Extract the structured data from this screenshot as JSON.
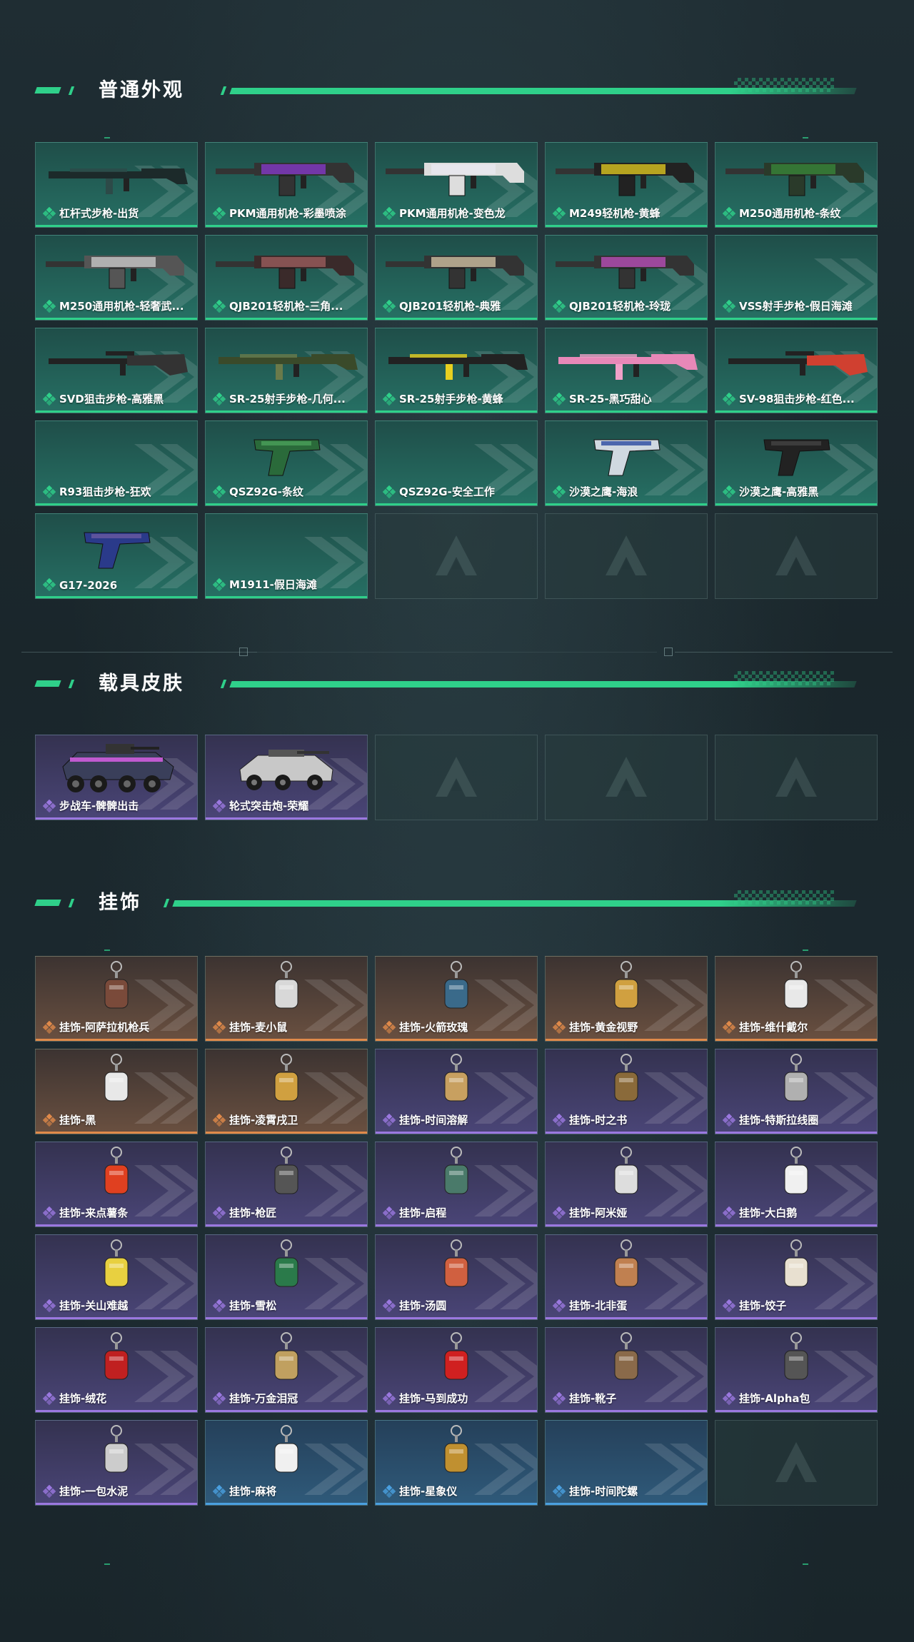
{
  "sections": {
    "weapons": {
      "title": "普通外观",
      "items": [
        {
          "label": "杠杆式步枪-出货",
          "rarity": "green",
          "art": "rifle-dark"
        },
        {
          "label": "PKM通用机枪-彩墨喷涂",
          "rarity": "green",
          "art": "mg-purple"
        },
        {
          "label": "PKM通用机枪-变色龙",
          "rarity": "green",
          "art": "mg-white"
        },
        {
          "label": "M249轻机枪-黄蜂",
          "rarity": "green",
          "art": "mg-yellow"
        },
        {
          "label": "M250通用机枪-条纹",
          "rarity": "green",
          "art": "mg-green"
        },
        {
          "label": "M250通用机枪-轻奢武...",
          "rarity": "green",
          "art": "mg-grey"
        },
        {
          "label": "QJB201轻机枪-三角...",
          "rarity": "green",
          "art": "mg-red"
        },
        {
          "label": "QJB201轻机枪-典雅",
          "rarity": "green",
          "art": "mg-tan"
        },
        {
          "label": "QJB201轻机枪-玲珑",
          "rarity": "green",
          "art": "mg-colorful"
        },
        {
          "label": "VSS射手步枪-假日海滩",
          "rarity": "green",
          "art": "none"
        },
        {
          "label": "SVD狙击步枪-高雅黑",
          "rarity": "green",
          "art": "sniper-black"
        },
        {
          "label": "SR-25射手步枪-几何...",
          "rarity": "green",
          "art": "rifle-camo"
        },
        {
          "label": "SR-25射手步枪-黄蜂",
          "rarity": "green",
          "art": "rifle-yellow"
        },
        {
          "label": "SR-25-黑巧甜心",
          "rarity": "green",
          "art": "rifle-pink"
        },
        {
          "label": "SV-98狙击步枪-红色...",
          "rarity": "green",
          "art": "sniper-red"
        },
        {
          "label": "R93狙击步枪-狂欢",
          "rarity": "green",
          "art": "none"
        },
        {
          "label": "QSZ92G-条纹",
          "rarity": "green",
          "art": "pistol-green"
        },
        {
          "label": "QSZ92G-安全工作",
          "rarity": "green",
          "art": "none"
        },
        {
          "label": "沙漠之鹰-海浪",
          "rarity": "green",
          "art": "pistol-blue"
        },
        {
          "label": "沙漠之鹰-高雅黑",
          "rarity": "green",
          "art": "pistol-black"
        },
        {
          "label": "G17-2026",
          "rarity": "green",
          "art": "pistol-navy"
        },
        {
          "label": "M1911-假日海滩",
          "rarity": "green",
          "art": "none"
        },
        {
          "label": "",
          "rarity": "empty",
          "art": "none"
        },
        {
          "label": "",
          "rarity": "empty",
          "art": "none"
        },
        {
          "label": "",
          "rarity": "empty",
          "art": "none"
        }
      ]
    },
    "vehicles": {
      "title": "载具皮肤",
      "items": [
        {
          "label": "步战车-髀髀出击",
          "rarity": "purple",
          "art": "vehicle-apc"
        },
        {
          "label": "轮式突击炮-荣耀",
          "rarity": "purple",
          "art": "vehicle-car"
        },
        {
          "label": "",
          "rarity": "empty",
          "art": "none"
        },
        {
          "label": "",
          "rarity": "empty",
          "art": "none"
        },
        {
          "label": "",
          "rarity": "empty",
          "art": "none"
        }
      ]
    },
    "charms": {
      "title": "挂饰",
      "items": [
        {
          "label": "挂饰-阿萨拉机枪兵",
          "rarity": "orange",
          "art": "charm-soldier"
        },
        {
          "label": "挂饰-麦小鼠",
          "rarity": "orange",
          "art": "charm-mouse"
        },
        {
          "label": "挂饰-火箭玫瑰",
          "rarity": "orange",
          "art": "charm-rocket"
        },
        {
          "label": "挂饰-黄金视野",
          "rarity": "orange",
          "art": "charm-figure"
        },
        {
          "label": "挂饰-维什戴尔",
          "rarity": "orange",
          "art": "charm-tag"
        },
        {
          "label": "挂饰-黑",
          "rarity": "orange",
          "art": "charm-tag"
        },
        {
          "label": "挂饰-凌霄戌卫",
          "rarity": "orange",
          "art": "charm-figure"
        },
        {
          "label": "挂饰-时间溶解",
          "rarity": "purple",
          "art": "charm-clock"
        },
        {
          "label": "挂饰-时之书",
          "rarity": "purple",
          "art": "charm-book"
        },
        {
          "label": "挂饰-特斯拉线圈",
          "rarity": "purple",
          "art": "charm-coil"
        },
        {
          "label": "挂饰-来点薯条",
          "rarity": "purple",
          "art": "charm-fries"
        },
        {
          "label": "挂饰-枪匠",
          "rarity": "purple",
          "art": "charm-box"
        },
        {
          "label": "挂饰-启程",
          "rarity": "purple",
          "art": "charm-badge"
        },
        {
          "label": "挂饰-阿米娅",
          "rarity": "purple",
          "art": "charm-bunny"
        },
        {
          "label": "挂饰-大白鹅",
          "rarity": "purple",
          "art": "charm-goose"
        },
        {
          "label": "挂饰-关山难越",
          "rarity": "purple",
          "art": "charm-can"
        },
        {
          "label": "挂饰-雪松",
          "rarity": "purple",
          "art": "charm-tree"
        },
        {
          "label": "挂饰-汤圆",
          "rarity": "purple",
          "art": "charm-bowl"
        },
        {
          "label": "挂饰-北非蛋",
          "rarity": "purple",
          "art": "charm-pan"
        },
        {
          "label": "挂饰-饺子",
          "rarity": "purple",
          "art": "charm-plate"
        },
        {
          "label": "挂饰-绒花",
          "rarity": "purple",
          "art": "charm-flower"
        },
        {
          "label": "挂饰-万金泪冠",
          "rarity": "purple",
          "art": "charm-crown"
        },
        {
          "label": "挂饰-马到成功",
          "rarity": "purple",
          "art": "charm-horse"
        },
        {
          "label": "挂饰-靴子",
          "rarity": "purple",
          "art": "charm-boot"
        },
        {
          "label": "挂饰-Alpha包",
          "rarity": "purple",
          "art": "charm-bag"
        },
        {
          "label": "挂饰-一包水泥",
          "rarity": "purple",
          "art": "charm-sack"
        },
        {
          "label": "挂饰-麻将",
          "rarity": "blue",
          "art": "charm-mahjong"
        },
        {
          "label": "挂饰-星象仪",
          "rarity": "blue",
          "art": "charm-globe"
        },
        {
          "label": "挂饰-时间陀螺",
          "rarity": "blue",
          "art": "none"
        },
        {
          "label": "",
          "rarity": "empty",
          "art": "none"
        }
      ]
    }
  },
  "colors": {
    "accent": "#2fd08a",
    "green_rarity": "#2fd08a",
    "purple_rarity": "#9b78e0",
    "orange_rarity": "#e08a4a",
    "blue_rarity": "#4aa0e0"
  },
  "icons": {
    "rarity": "diamond-cluster-icon",
    "empty": "chevron-logo-icon"
  }
}
